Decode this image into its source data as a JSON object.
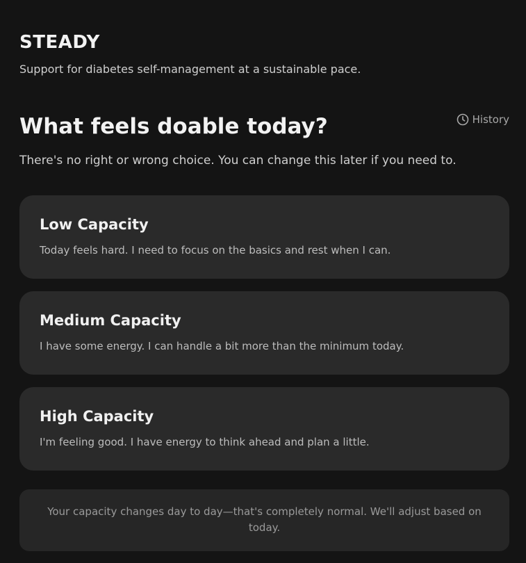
{
  "app": {
    "brand": "STEADY",
    "tagline": "Support for diabetes self-management at a sustainable pace."
  },
  "prompt": {
    "question": "What feels doable today?",
    "subtitle": "There's no right or wrong choice. You can change this later if you need to."
  },
  "history": {
    "label": "History",
    "icon": "clock-icon"
  },
  "options": [
    {
      "title": "Low Capacity",
      "description": "Today feels hard. I need to focus on the basics and rest when I can."
    },
    {
      "title": "Medium Capacity",
      "description": "I have some energy. I can handle a bit more than the minimum today."
    },
    {
      "title": "High Capacity",
      "description": "I'm feeling good. I have energy to think ahead and plan a little."
    }
  ],
  "note": {
    "text": "Your capacity changes day to day—that's completely normal. We'll adjust based on today."
  },
  "colors": {
    "background": "#141414",
    "card": "#2a2a2a",
    "note": "#262626",
    "text": "#e6e6e6",
    "muted": "#9a9a9a"
  }
}
